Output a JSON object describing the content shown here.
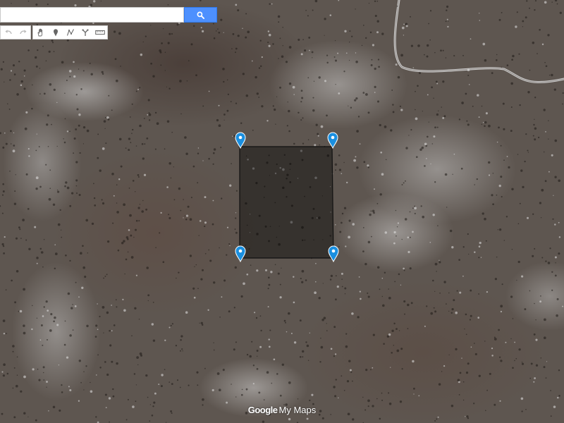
{
  "search": {
    "value": "",
    "placeholder": ""
  },
  "toolbar": {
    "icons": [
      "undo-icon",
      "redo-icon",
      "hand-icon",
      "marker-icon",
      "line-icon",
      "directions-icon",
      "ruler-icon"
    ]
  },
  "logo": {
    "brand": "Google",
    "product": "My Maps"
  },
  "colors": {
    "marker": "#1a8fe0",
    "search_button": "#4d90fe",
    "polygon_fill": "#000000"
  }
}
